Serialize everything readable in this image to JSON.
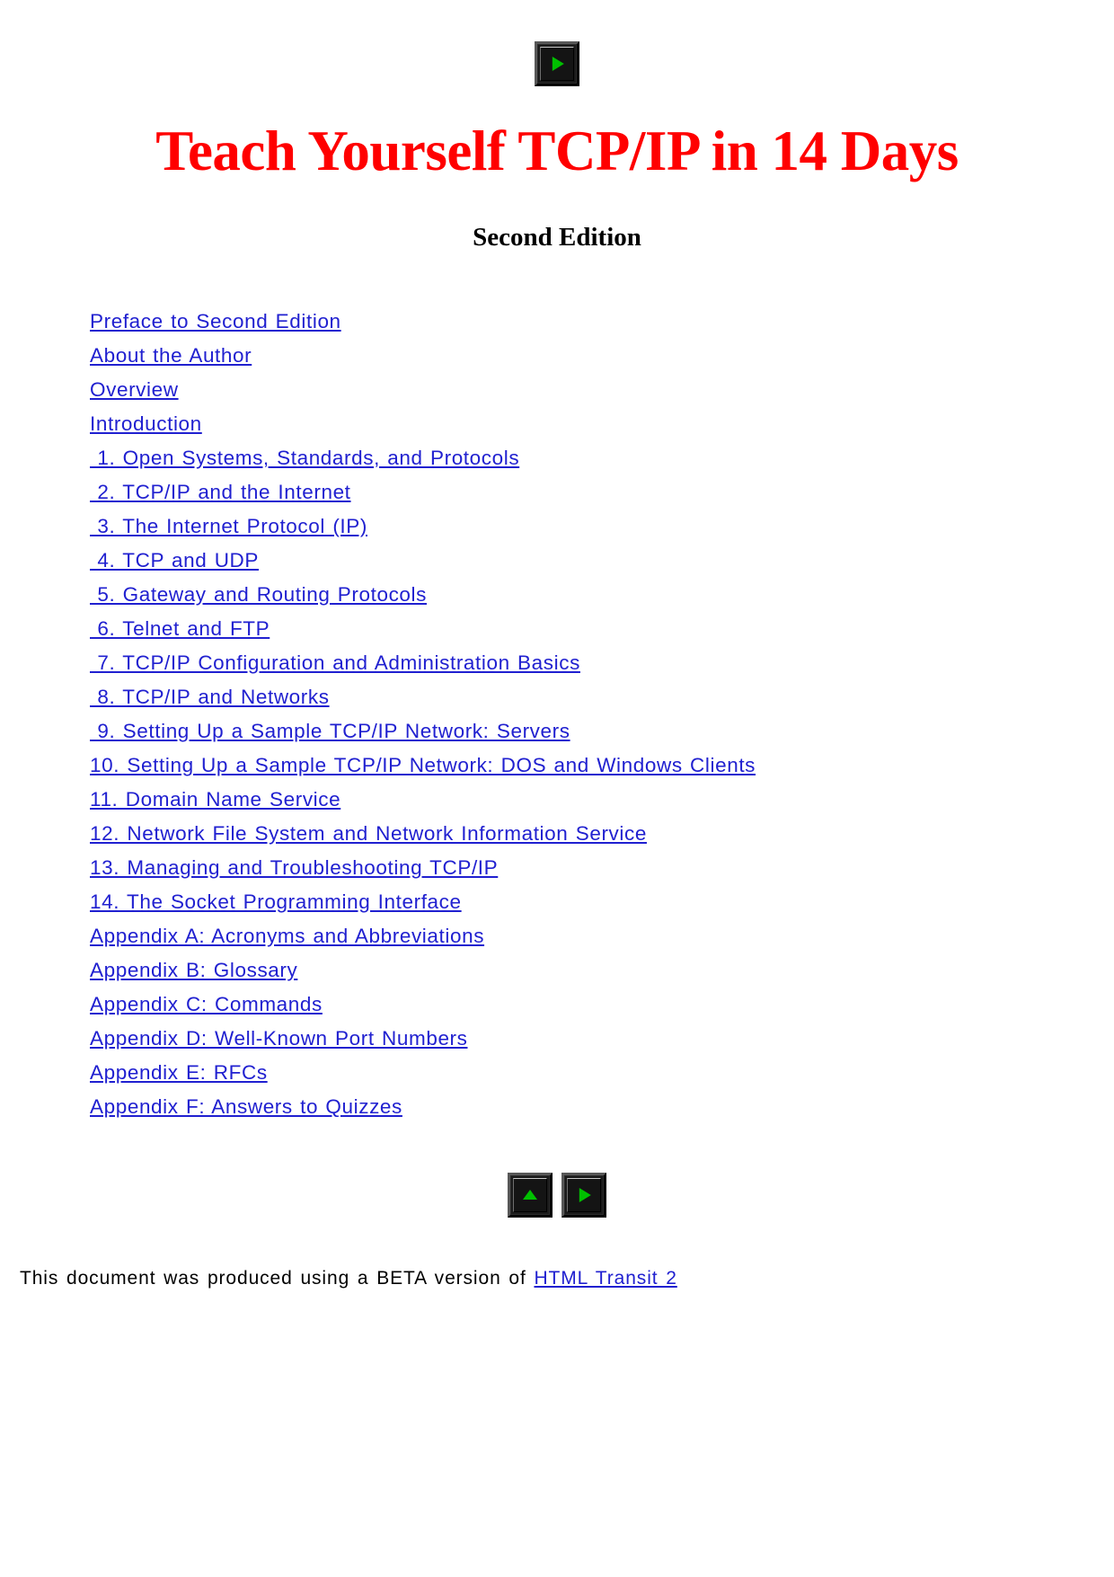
{
  "document": {
    "title": "Teach Yourself TCP/IP in 14 Days",
    "subtitle": "Second Edition",
    "title_color": "#ff0000",
    "link_color": "#2020d0",
    "background_color": "#ffffff"
  },
  "top_nav": {
    "buttons": [
      {
        "name": "next-button",
        "icon": "right-triangle-icon",
        "glyph": "▶"
      }
    ]
  },
  "toc": {
    "items": [
      {
        "label": "Preface to Second Edition"
      },
      {
        "label": "About the Author"
      },
      {
        "label": "Overview"
      },
      {
        "label": "Introduction"
      },
      {
        "label": " 1. Open Systems, Standards, and Protocols"
      },
      {
        "label": " 2. TCP/IP and the Internet"
      },
      {
        "label": " 3. The Internet Protocol (IP)"
      },
      {
        "label": " 4. TCP and UDP"
      },
      {
        "label": " 5. Gateway and Routing Protocols"
      },
      {
        "label": " 6. Telnet and FTP"
      },
      {
        "label": " 7. TCP/IP Configuration and Administration Basics"
      },
      {
        "label": " 8. TCP/IP and Networks"
      },
      {
        "label": " 9. Setting Up a Sample TCP/IP Network: Servers"
      },
      {
        "label": "10. Setting Up a Sample TCP/IP Network: DOS and Windows Clients"
      },
      {
        "label": "11. Domain Name Service"
      },
      {
        "label": "12. Network File System and Network Information Service"
      },
      {
        "label": "13. Managing and Troubleshooting TCP/IP"
      },
      {
        "label": "14. The Socket Programming Interface"
      },
      {
        "label": "Appendix A: Acronyms and Abbreviations"
      },
      {
        "label": "Appendix B: Glossary"
      },
      {
        "label": "Appendix C: Commands"
      },
      {
        "label": "Appendix D: Well-Known Port Numbers"
      },
      {
        "label": "Appendix E: RFCs"
      },
      {
        "label": "Appendix F: Answers to Quizzes"
      }
    ]
  },
  "bottom_nav": {
    "buttons": [
      {
        "name": "up-button",
        "icon": "up-triangle-icon",
        "glyph": "▲"
      },
      {
        "name": "next-button",
        "icon": "right-triangle-icon",
        "glyph": "▶"
      }
    ]
  },
  "footer": {
    "note_prefix": "This document was produced using a BETA version of ",
    "link_label": "HTML Transit 2"
  }
}
